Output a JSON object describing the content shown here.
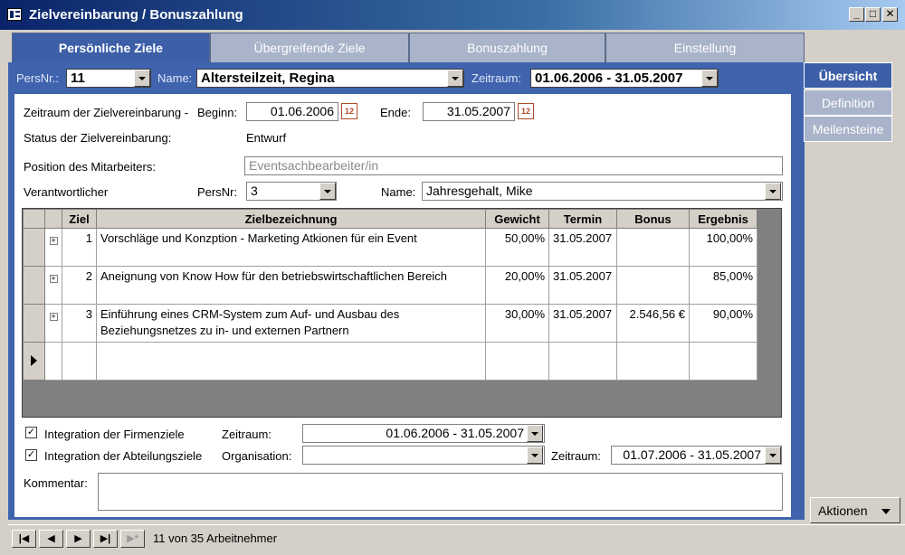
{
  "window": {
    "title": "Zielvereinbarung / Bonuszahlung",
    "min": "_",
    "max": "□",
    "close": "✕"
  },
  "tabs": [
    {
      "label": "Persönliche Ziele"
    },
    {
      "label": "Übergreifende Ziele"
    },
    {
      "label": "Bonuszahlung"
    },
    {
      "label": "Einstellung"
    }
  ],
  "selector": {
    "persnr_label": "PersNr.:",
    "persnr_value": "11",
    "name_label": "Name:",
    "name_value": "Altersteilzeit, Regina",
    "zeitraum_label": "Zeitraum:",
    "zeitraum_value": "01.06.2006 - 31.05.2007"
  },
  "side_tabs": [
    {
      "label": "Übersicht"
    },
    {
      "label": "Definition"
    },
    {
      "label": "Meilensteine"
    }
  ],
  "form": {
    "zeitraum_label": "Zeitraum der Zielvereinbarung -",
    "beginn_label": "Beginn:",
    "beginn_value": "01.06.2006",
    "ende_label": "Ende:",
    "ende_value": "31.05.2007",
    "cal_icon": "12",
    "status_label": "Status der Zielvereinbarung:",
    "status_value": "Entwurf",
    "position_label": "Position des Mitarbeiters:",
    "position_value": "Eventsachbearbeiter/in",
    "verantw_label": "Verantwortlicher",
    "persnr_label": "PersNr:",
    "persnr_value": "3",
    "name_label": "Name:",
    "name_value": "Jahresgehalt, Mike"
  },
  "grid": {
    "columns": [
      "Ziel",
      "Zielbezeichnung",
      "Gewicht",
      "Termin",
      "Bonus",
      "Ergebnis"
    ],
    "rows": [
      {
        "ziel": "1",
        "bez": "Vorschläge und Konzption - Marketing Atkionen für ein Event",
        "gewicht": "50,00%",
        "termin": "31.05.2007",
        "bonus": "",
        "ergebnis": "100,00%"
      },
      {
        "ziel": "2",
        "bez": "Aneignung von Know How für den betriebswirtschaftlichen Bereich",
        "gewicht": "20,00%",
        "termin": "31.05.2007",
        "bonus": "",
        "ergebnis": "85,00%"
      },
      {
        "ziel": "3",
        "bez": "Einführung eines CRM-System zum Auf- und Ausbau des Beziehungsnetzes zu in- und externen Partnern",
        "gewicht": "30,00%",
        "termin": "31.05.2007",
        "bonus": "2.546,56 €",
        "ergebnis": "90,00%"
      }
    ],
    "expand_glyph": "+"
  },
  "bottom": {
    "firmen_label": "Integration der Firmenziele",
    "firmen_checked": "✓",
    "zeitraum_label": "Zeitraum:",
    "firmen_zeitraum": "01.06.2006 - 31.05.2007",
    "abteilung_label": "Integration der Abteilungsziele",
    "abteilung_checked": "✓",
    "organisation_label": "Organisation:",
    "organisation_value": "",
    "zeitraum2_label": "Zeitraum:",
    "abteilung_zeitraum": "01.07.2006 - 31.05.2007",
    "kommentar_label": "Kommentar:",
    "kommentar_value": ""
  },
  "aktionen_label": "Aktionen",
  "nav": {
    "first": "|◀",
    "prev": "◀",
    "next": "▶",
    "last": "▶|",
    "new": "▶*",
    "record_text": "11 von 35 Arbeitnehmer"
  }
}
